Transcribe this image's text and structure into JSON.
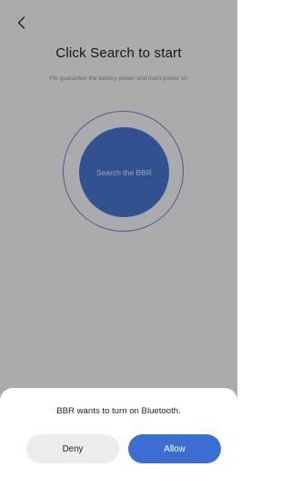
{
  "header": {
    "back_icon": "chevron-left-icon"
  },
  "main": {
    "title": "Click Search to start",
    "subtitle": "Pls guarantee the battery power and main power on",
    "search_button_label": "Search the BBR"
  },
  "dialog": {
    "message": "BBR wants to turn on Bluetooth.",
    "deny_label": "Deny",
    "allow_label": "Allow"
  },
  "colors": {
    "accent": "#4a7ad8",
    "allow_button": "#3a6fd1",
    "deny_button": "#ececec",
    "scrim": "rgba(0,0,0,0.33)"
  }
}
